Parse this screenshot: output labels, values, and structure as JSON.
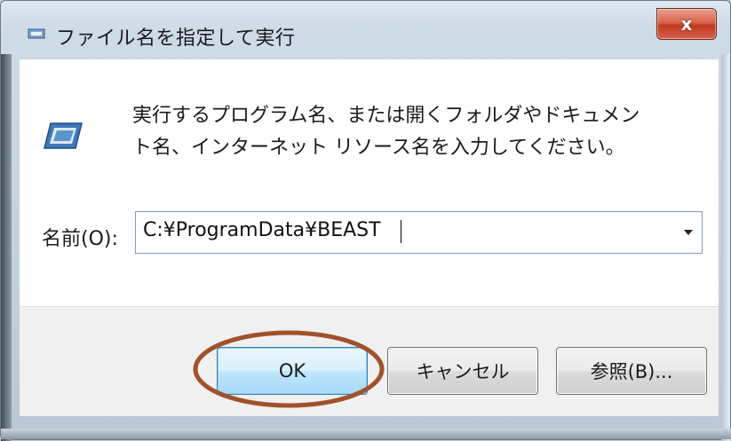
{
  "window": {
    "title": "ファイル名を指定して実行",
    "close_label": "x"
  },
  "description": {
    "line1": "実行するプログラム名、または開くフォルダやドキュメン",
    "line2": "ト名、インターネット リソース名を入力してください。"
  },
  "name_field": {
    "label": "名前(O):",
    "value": "C:¥ProgramData¥BEAST"
  },
  "buttons": {
    "ok": "OK",
    "cancel": "キャンセル",
    "browse": "参照(B)..."
  },
  "annotation": {
    "color": "#a0522d",
    "target": "ok-button"
  }
}
